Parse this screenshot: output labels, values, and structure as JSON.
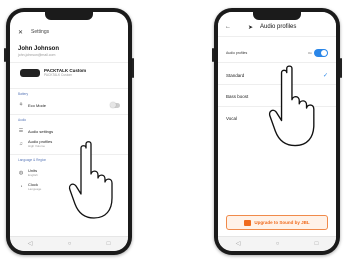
{
  "left_phone": {
    "status": {
      "time": "",
      "icons": ""
    },
    "title": "Settings",
    "close_icon": "close-icon",
    "user": {
      "name": "John Johnson",
      "email": "john.johnson@mail.com"
    },
    "device": {
      "name": "PACKTALK Custom",
      "sub": "PACKTALK Custom"
    },
    "sections": {
      "battery": "Battery",
      "audio": "Audio",
      "language": "Language & Region"
    },
    "eco_mode": {
      "label": "Eco Mode"
    },
    "audio_settings": {
      "label": "Audio settings"
    },
    "audio_profiles": {
      "label": "Audio profiles",
      "sub": "High Volume"
    },
    "lang_items": [
      {
        "label": "Units",
        "sub": "English"
      },
      {
        "label": "Clock",
        "sub": "Language"
      }
    ]
  },
  "right_phone": {
    "title": "Audio profiles",
    "audio_profiles_toggle": {
      "label": "Audio profiles",
      "state": "On"
    },
    "options": [
      "Standard",
      "Bass boost",
      "Vocal"
    ],
    "selected": "Standard",
    "upgrade_label": "Upgrade to Sound by JBL"
  },
  "colors": {
    "accent": "#2a86e8",
    "upgrade": "#f06a1c",
    "phone_frame": "#1b1b1b"
  }
}
